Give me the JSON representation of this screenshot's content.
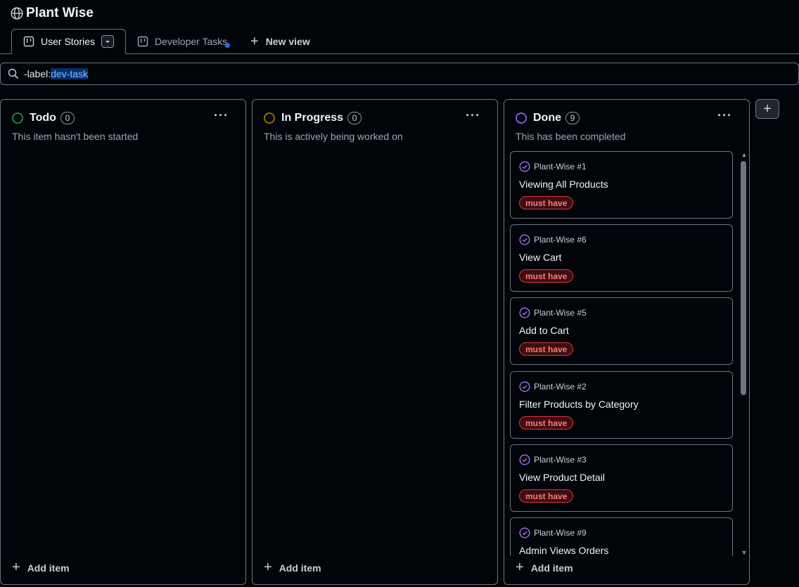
{
  "project": {
    "title": "Plant Wise"
  },
  "tabs": [
    {
      "label": "User Stories",
      "active": true
    },
    {
      "label": "Developer Tasks",
      "active": false,
      "has_update_dot": true
    }
  ],
  "new_view_label": "New view",
  "filter": {
    "key": "-label:",
    "value": "dev-task"
  },
  "colors": {
    "todo_status": "#238636",
    "in_progress_status": "#9e6a03",
    "done_status": "#8957e5",
    "label_border": "#da3633",
    "label_text": "#ff7b72",
    "accent": "#1f6feb"
  },
  "columns": [
    {
      "name": "Todo",
      "count": "0",
      "description": "This item hasn't been started",
      "add_label": "Add item"
    },
    {
      "name": "In Progress",
      "count": "0",
      "description": "This is actively being worked on",
      "add_label": "Add item"
    },
    {
      "name": "Done",
      "count": "9",
      "description": "This has been completed",
      "add_label": "Add item"
    }
  ],
  "done_cards": [
    {
      "ref": "Plant-Wise #1",
      "title": "Viewing All Products",
      "label": "must have"
    },
    {
      "ref": "Plant-Wise #6",
      "title": "View Cart",
      "label": "must have"
    },
    {
      "ref": "Plant-Wise #5",
      "title": "Add to Cart",
      "label": "must have"
    },
    {
      "ref": "Plant-Wise #2",
      "title": "Filter Products by Category",
      "label": "must have"
    },
    {
      "ref": "Plant-Wise #3",
      "title": "View Product Detail",
      "label": "must have"
    },
    {
      "ref": "Plant-Wise #9",
      "title": "Admin Views Orders",
      "label": ""
    }
  ],
  "column_menu_glyph": "···",
  "add_column_glyph": "+"
}
